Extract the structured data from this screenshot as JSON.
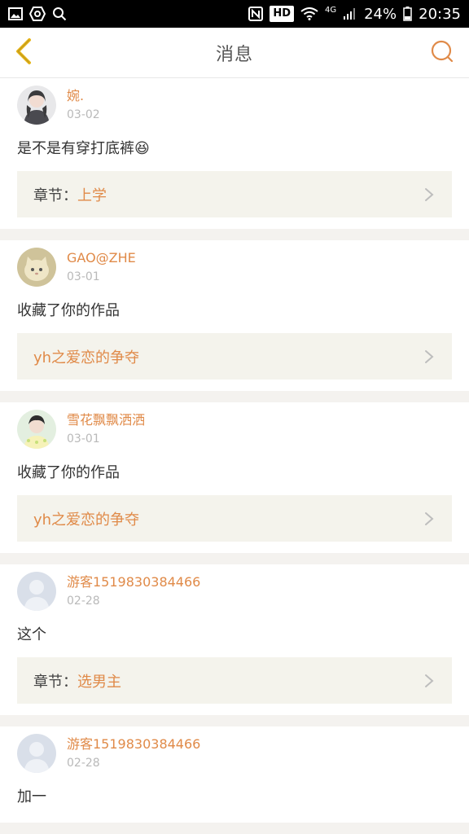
{
  "status_bar": {
    "left_icons": [
      "image-icon",
      "settings-hex-icon",
      "search-icon"
    ],
    "nfc": "N",
    "hd": "HD",
    "network": "4G",
    "battery": "24%",
    "time": "20:35"
  },
  "header": {
    "title": "消息",
    "back_icon": "chevron-left-icon",
    "search_icon": "search-icon"
  },
  "messages": [
    {
      "username": "婉.",
      "date": "03-02",
      "text": "是不是有穿打底裤😆",
      "ref_label": "章节：",
      "ref_title": "上学",
      "avatar": "girl-photo"
    },
    {
      "username": "GAO@ZHE",
      "date": "03-01",
      "text": "收藏了你的作品",
      "ref_label": "",
      "ref_title": "yh之爱恋的争夺",
      "avatar": "kitten-photo"
    },
    {
      "username": "雪花飘飘洒洒",
      "date": "03-01",
      "text": "收藏了你的作品",
      "ref_label": "",
      "ref_title": "yh之爱恋的争夺",
      "avatar": "boy-photo"
    },
    {
      "username": "游客1519830384466",
      "date": "02-28",
      "text": "这个",
      "ref_label": "章节：",
      "ref_title": "选男主",
      "avatar": "default-avatar"
    },
    {
      "username": "游客1519830384466",
      "date": "02-28",
      "text": "加一",
      "ref_label": "",
      "ref_title": "",
      "avatar": "default-avatar"
    }
  ],
  "colors": {
    "accent": "#e08a48",
    "ref_bg": "#f4f3ec",
    "date": "#b9b9b9"
  }
}
